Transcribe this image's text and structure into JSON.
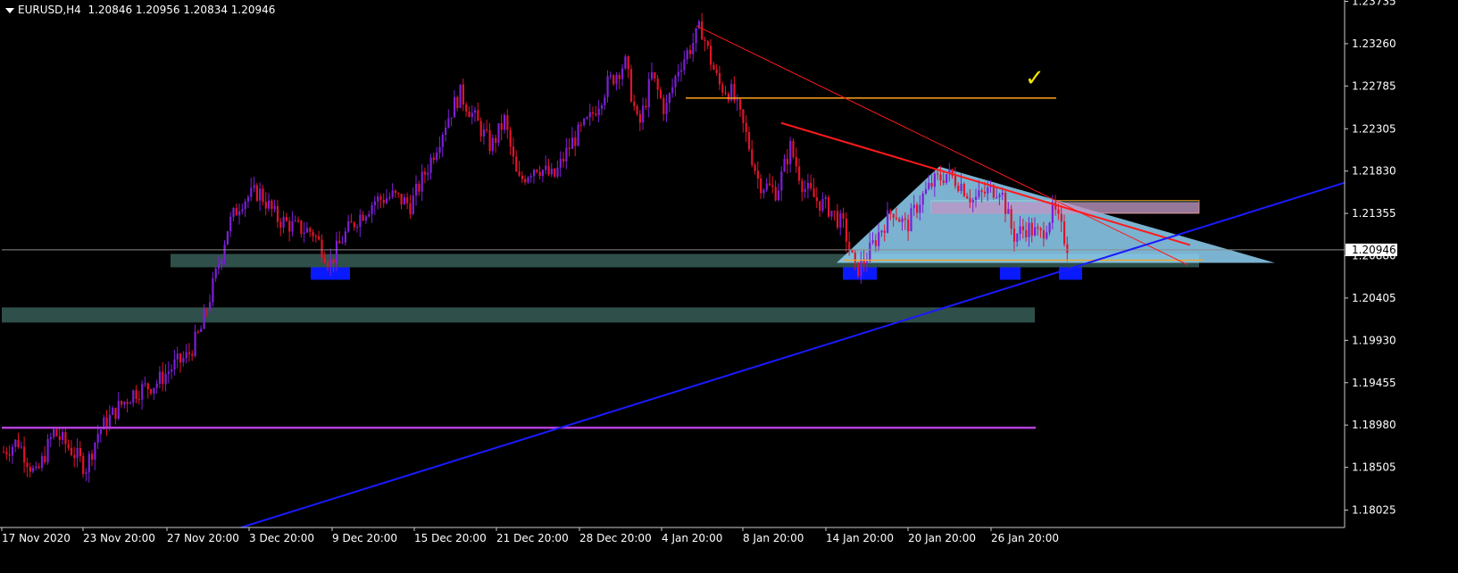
{
  "header": {
    "symbol_timeframe": "EURUSD,H4",
    "ohlc": "1.20846 1.20956 1.20834 1.20946"
  },
  "annotations": {
    "checkmark": "✓",
    "current_price_label": "1.20946"
  },
  "colors": {
    "background": "#000000",
    "bull": "#7b1fd6",
    "bear": "#e0132b",
    "axis_text": "#ffffff",
    "zone": "#2f4f4a",
    "support_box": "#0a1aff",
    "triangle": "#8fd1f5",
    "trend_red": "#ff1a1a",
    "trend_blue": "#1a1aff",
    "level_orange": "#ffa31a",
    "level_purple": "#b23fd8"
  },
  "chart_data": {
    "type": "candlestick",
    "symbol": "EURUSD",
    "timeframe": "H4",
    "ylim": [
      1.1783,
      1.2375
    ],
    "y_ticks": [
      "1.23735",
      "1.23260",
      "1.22785",
      "1.22305",
      "1.21830",
      "1.21355",
      "1.20880",
      "1.20405",
      "1.19930",
      "1.19455",
      "1.18980",
      "1.18505",
      "1.18025"
    ],
    "x_ticks": [
      "17 Nov 2020",
      "23 Nov 20:00",
      "27 Nov 20:00",
      "3 Dec 20:00",
      "9 Dec 20:00",
      "15 Dec 20:00",
      "21 Dec 20:00",
      "28 Dec 20:00",
      "4 Jan 20:00",
      "8 Jan 20:00",
      "14 Jan 20:00",
      "20 Jan 20:00",
      "26 Jan 20:00"
    ],
    "current_price": 1.20946,
    "price_path": [
      [
        0,
        1.1865
      ],
      [
        20,
        1.188
      ],
      [
        40,
        1.184
      ],
      [
        60,
        1.189
      ],
      [
        80,
        1.187
      ],
      [
        96,
        1.185
      ],
      [
        110,
        1.189
      ],
      [
        130,
        1.1915
      ],
      [
        150,
        1.1935
      ],
      [
        175,
        1.1945
      ],
      [
        195,
        1.1965
      ],
      [
        210,
        1.1975
      ],
      [
        225,
        1.2005
      ],
      [
        240,
        1.206
      ],
      [
        255,
        1.212
      ],
      [
        270,
        1.215
      ],
      [
        290,
        1.216
      ],
      [
        310,
        1.213
      ],
      [
        330,
        1.212
      ],
      [
        350,
        1.2115
      ],
      [
        370,
        1.208
      ],
      [
        385,
        1.211
      ],
      [
        400,
        1.213
      ],
      [
        420,
        1.215
      ],
      [
        440,
        1.2155
      ],
      [
        460,
        1.2145
      ],
      [
        480,
        1.219
      ],
      [
        500,
        1.224
      ],
      [
        515,
        1.227
      ],
      [
        530,
        1.2245
      ],
      [
        550,
        1.221
      ],
      [
        565,
        1.224
      ],
      [
        580,
        1.217
      ],
      [
        600,
        1.219
      ],
      [
        620,
        1.2175
      ],
      [
        640,
        1.2215
      ],
      [
        660,
        1.224
      ],
      [
        680,
        1.228
      ],
      [
        700,
        1.2305
      ],
      [
        715,
        1.223
      ],
      [
        730,
        1.229
      ],
      [
        745,
        1.225
      ],
      [
        760,
        1.23
      ],
      [
        775,
        1.2325
      ],
      [
        785,
        1.2345
      ],
      [
        795,
        1.231
      ],
      [
        805,
        1.228
      ],
      [
        820,
        1.227
      ],
      [
        835,
        1.2225
      ],
      [
        850,
        1.217
      ],
      [
        870,
        1.216
      ],
      [
        885,
        1.221
      ],
      [
        900,
        1.2165
      ],
      [
        915,
        1.215
      ],
      [
        930,
        1.214
      ],
      [
        945,
        1.212
      ],
      [
        958,
        1.207
      ],
      [
        970,
        1.2085
      ],
      [
        985,
        1.2115
      ],
      [
        1000,
        1.214
      ],
      [
        1015,
        1.212
      ],
      [
        1030,
        1.215
      ],
      [
        1045,
        1.217
      ],
      [
        1060,
        1.218
      ],
      [
        1075,
        1.217
      ],
      [
        1090,
        1.215
      ],
      [
        1105,
        1.216
      ],
      [
        1120,
        1.2165
      ],
      [
        1135,
        1.211
      ],
      [
        1150,
        1.212
      ],
      [
        1165,
        1.211
      ],
      [
        1180,
        1.214
      ],
      [
        1195,
        1.21
      ],
      [
        1200,
        1.20946
      ]
    ],
    "levels": [
      {
        "kind": "resistance",
        "price": 1.2265,
        "color": "orange"
      },
      {
        "kind": "support",
        "price": 1.1895,
        "color": "purple"
      }
    ],
    "zones": [
      {
        "top": 1.209,
        "bottom": 1.2075
      },
      {
        "top": 1.203,
        "bottom": 1.2013
      },
      {
        "top": 1.215,
        "bottom": 1.2136
      }
    ]
  }
}
